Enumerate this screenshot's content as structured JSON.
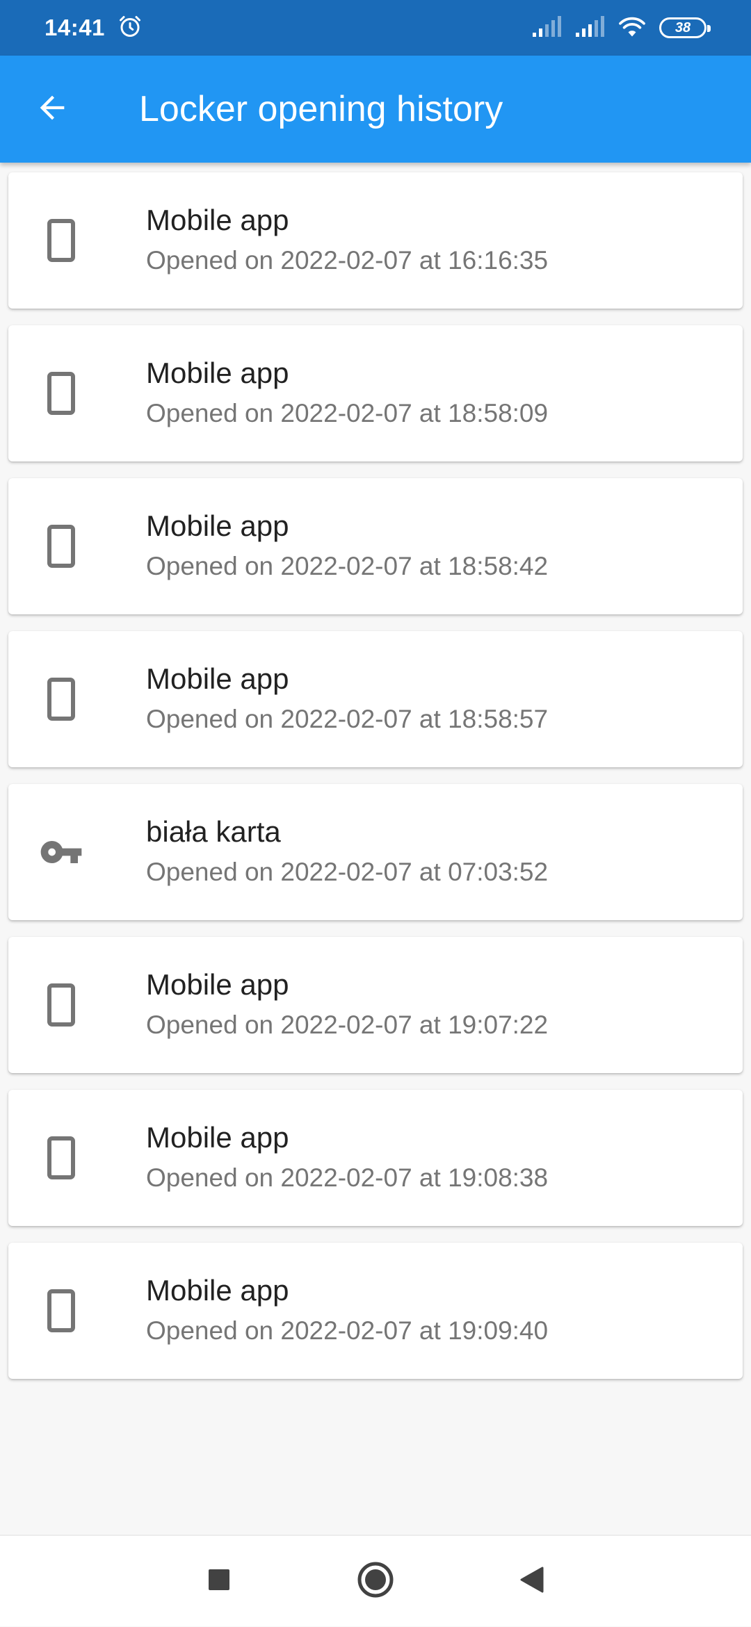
{
  "status_bar": {
    "time": "14:41",
    "battery": "38",
    "icons": [
      "alarm-icon",
      "signal-icon",
      "signal-icon",
      "wifi-icon",
      "battery-icon"
    ]
  },
  "app_bar": {
    "title": "Locker opening history",
    "back_icon": "arrow-back-icon",
    "background": "#2196f3"
  },
  "history": [
    {
      "method": "Mobile app",
      "opened": "Opened on 2022-02-07 at 16:16:35",
      "icon": "phone-icon"
    },
    {
      "method": "Mobile app",
      "opened": "Opened on 2022-02-07 at 18:58:09",
      "icon": "phone-icon"
    },
    {
      "method": "Mobile app",
      "opened": "Opened on 2022-02-07 at 18:58:42",
      "icon": "phone-icon"
    },
    {
      "method": "Mobile app",
      "opened": "Opened on 2022-02-07 at 18:58:57",
      "icon": "phone-icon"
    },
    {
      "method": "biała karta",
      "opened": "Opened on 2022-02-07 at 07:03:52",
      "icon": "key-icon"
    },
    {
      "method": "Mobile app",
      "opened": "Opened on 2022-02-07 at 19:07:22",
      "icon": "phone-icon"
    },
    {
      "method": "Mobile app",
      "opened": "Opened on 2022-02-07 at 19:08:38",
      "icon": "phone-icon"
    },
    {
      "method": "Mobile app",
      "opened": "Opened on 2022-02-07 at 19:09:40",
      "icon": "phone-icon"
    }
  ],
  "nav_bar": {
    "icons": [
      "recents-square-icon",
      "home-circle-icon",
      "back-triangle-icon"
    ]
  }
}
